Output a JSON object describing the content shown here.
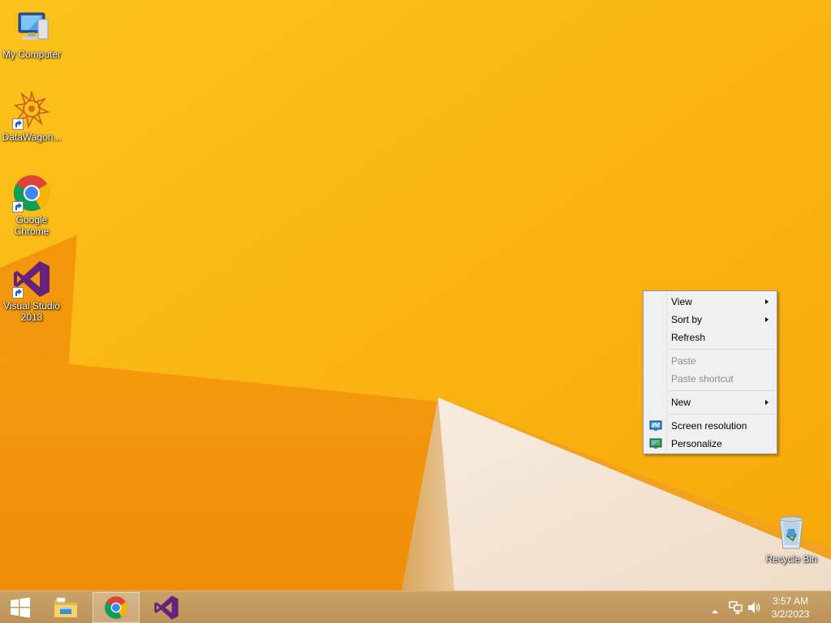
{
  "desktop": {
    "icons": [
      {
        "label": "My Computer"
      },
      {
        "label": "DataWagon..."
      },
      {
        "label": "Google Chrome"
      },
      {
        "label": "Visual Studio 2013"
      },
      {
        "label": "Recycle Bin"
      }
    ]
  },
  "context_menu": {
    "items": [
      {
        "label": "View",
        "submenu": true,
        "enabled": true
      },
      {
        "label": "Sort by",
        "submenu": true,
        "enabled": true
      },
      {
        "label": "Refresh",
        "submenu": false,
        "enabled": true
      },
      {
        "label": "Paste",
        "submenu": false,
        "enabled": false
      },
      {
        "label": "Paste shortcut",
        "submenu": false,
        "enabled": false
      },
      {
        "label": "New",
        "submenu": true,
        "enabled": true
      },
      {
        "label": "Screen resolution",
        "icon": "screen-resolution-icon",
        "enabled": true
      },
      {
        "label": "Personalize",
        "icon": "personalize-icon",
        "enabled": true
      }
    ]
  },
  "taskbar": {
    "buttons": [
      {
        "name": "start",
        "icon": "windows-logo-icon"
      },
      {
        "name": "file-explorer",
        "icon": "folder-icon"
      },
      {
        "name": "google-chrome",
        "icon": "chrome-icon",
        "active": true
      },
      {
        "name": "visual-studio",
        "icon": "visual-studio-icon"
      }
    ],
    "tray": {
      "icons": [
        "show-hidden-icons-arrow",
        "network-icon",
        "volume-icon"
      ]
    },
    "clock": {
      "time": "3:57 AM",
      "date": "3/2/2023"
    }
  },
  "colors": {
    "wallpaper": "#f9b20c",
    "wallpaper_light": "#f5e6cf",
    "taskbar": "#c39a60",
    "vs_purple": "#68217a"
  }
}
